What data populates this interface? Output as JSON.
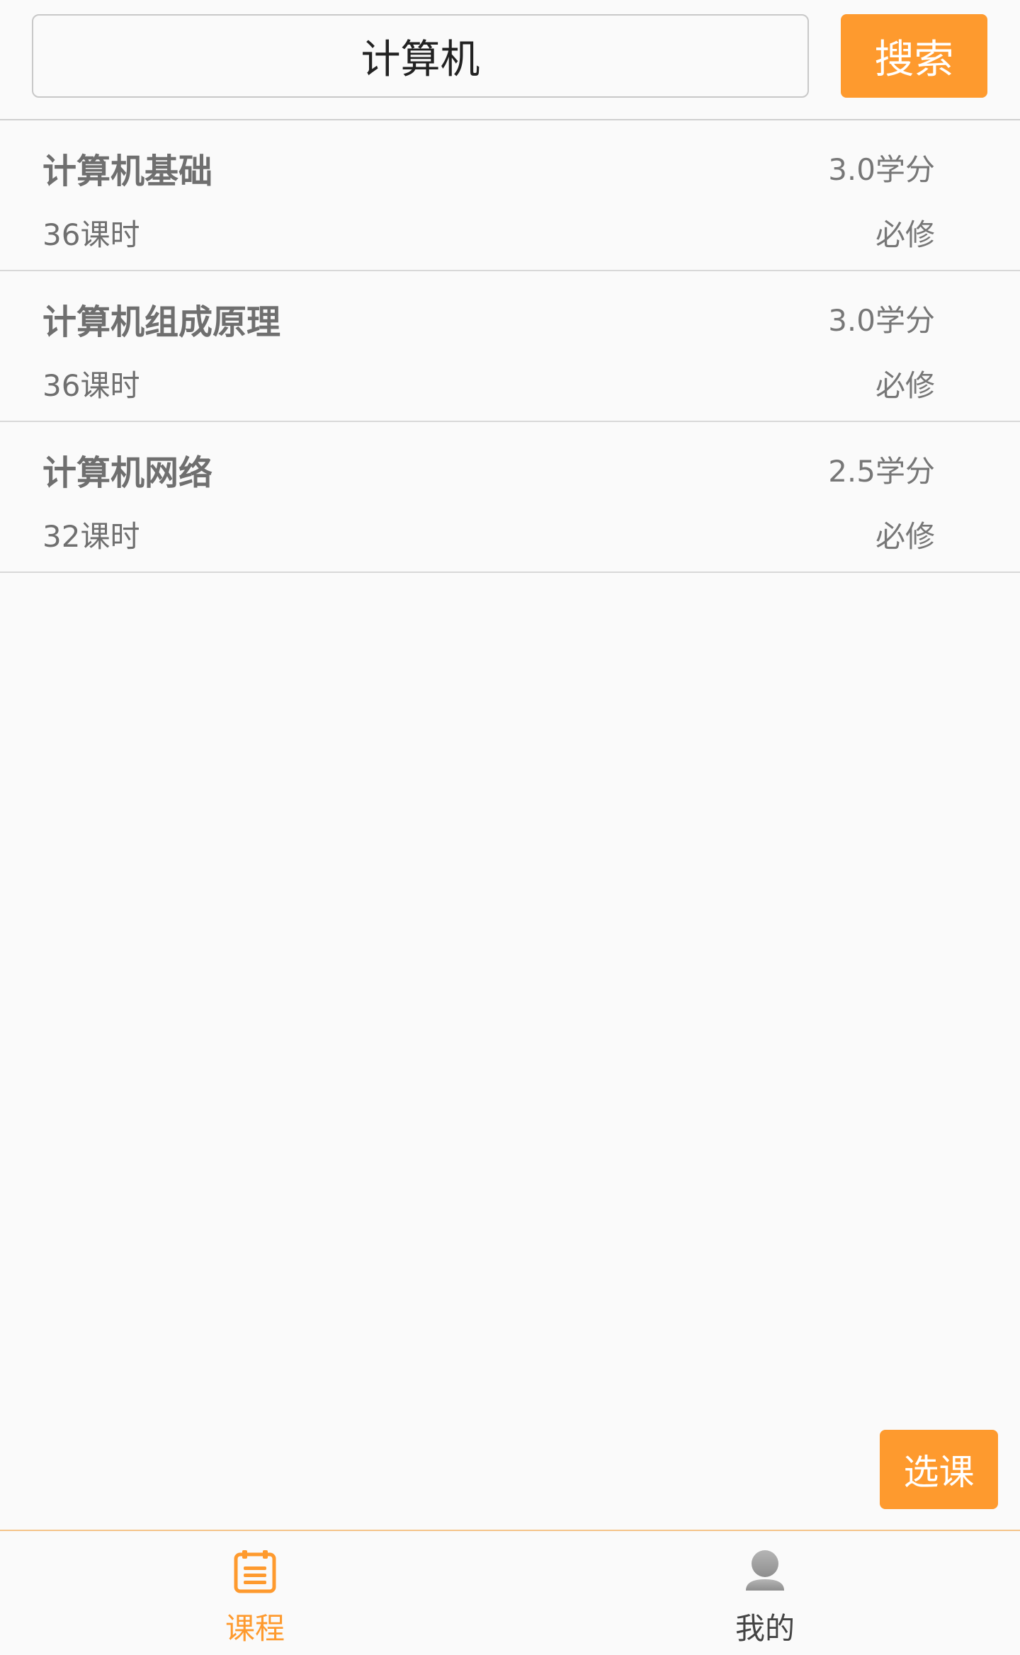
{
  "search": {
    "value": "计算机",
    "button_label": "搜索"
  },
  "courses": [
    {
      "name": "计算机基础",
      "hours": "36课时",
      "credits": "3.0学分",
      "type": "必修"
    },
    {
      "name": "计算机组成原理",
      "hours": "36课时",
      "credits": "3.0学分",
      "type": "必修"
    },
    {
      "name": "计算机网络",
      "hours": "32课时",
      "credits": "2.5学分",
      "type": "必修"
    }
  ],
  "select_button_label": "选课",
  "bottom_nav": {
    "tabs": [
      {
        "label": "课程",
        "icon": "course-calendar-icon",
        "active": true
      },
      {
        "label": "我的",
        "icon": "user-avatar-icon",
        "active": false
      }
    ]
  },
  "colors": {
    "accent": "#fe9a2e",
    "inactive_text": "#444444",
    "inactive_icon": "#9b9b9b"
  }
}
